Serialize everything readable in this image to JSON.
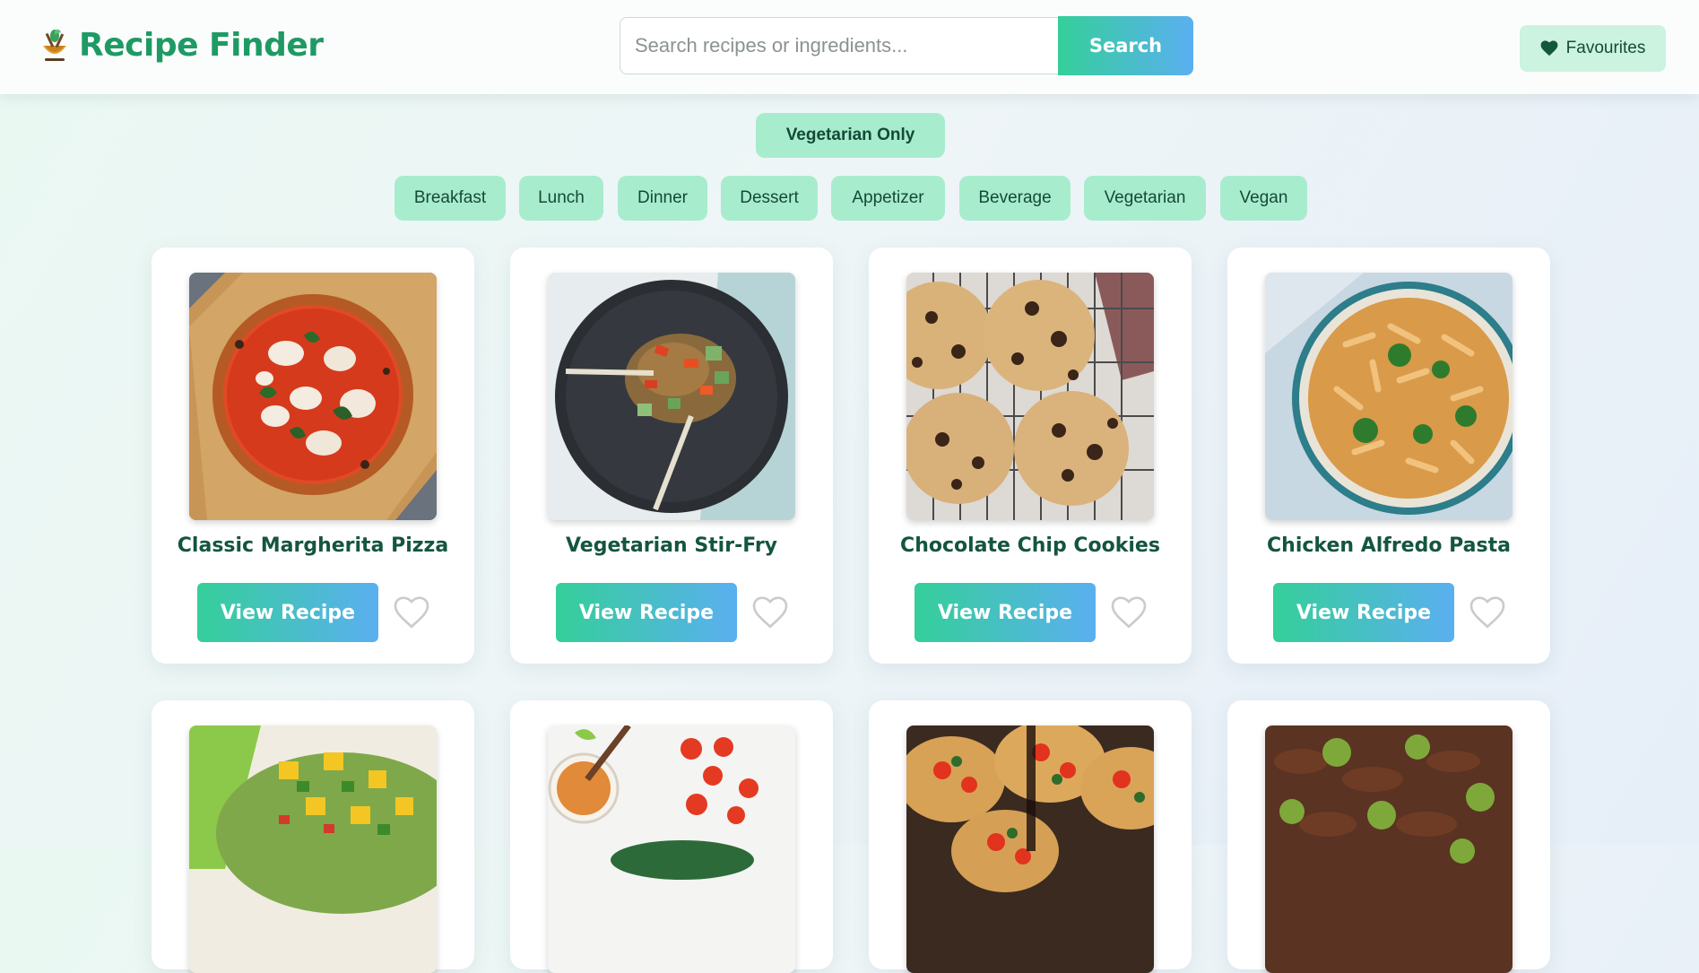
{
  "header": {
    "app_title": "Recipe Finder",
    "logo_icon": "chef-bowl-icon",
    "search": {
      "placeholder": "Search recipes or ingredients...",
      "value": "",
      "button_label": "Search"
    },
    "favourites_label": "Favourites",
    "favourites_icon": "heart-icon"
  },
  "filters": {
    "vegetarian_only_label": "Vegetarian Only",
    "categories": [
      "Breakfast",
      "Lunch",
      "Dinner",
      "Dessert",
      "Appetizer",
      "Beverage",
      "Vegetarian",
      "Vegan"
    ]
  },
  "recipes": [
    {
      "title": "Classic Margherita Pizza",
      "image": "margherita-pizza-photo",
      "button_label": "View Recipe"
    },
    {
      "title": "Vegetarian Stir-Fry",
      "image": "vegetable-stir-fry-photo",
      "button_label": "View Recipe"
    },
    {
      "title": "Chocolate Chip Cookies",
      "image": "chocolate-chip-cookies-photo",
      "button_label": "View Recipe"
    },
    {
      "title": "Chicken Alfredo Pasta",
      "image": "chicken-alfredo-pasta-photo",
      "button_label": "View Recipe"
    },
    {
      "title": "",
      "image": "mango-salsa-photo",
      "button_label": ""
    },
    {
      "title": "",
      "image": "dressing-tomatoes-photo",
      "button_label": ""
    },
    {
      "title": "",
      "image": "bruschetta-photo",
      "button_label": ""
    },
    {
      "title": "",
      "image": "beef-broccoli-photo",
      "button_label": ""
    }
  ],
  "colors": {
    "brand_green": "#1e9a64",
    "chip_bg": "#a8ecce",
    "gradient_start": "#35cf9a",
    "gradient_end": "#5aaff0",
    "heart_outline": "#c9cccc"
  }
}
